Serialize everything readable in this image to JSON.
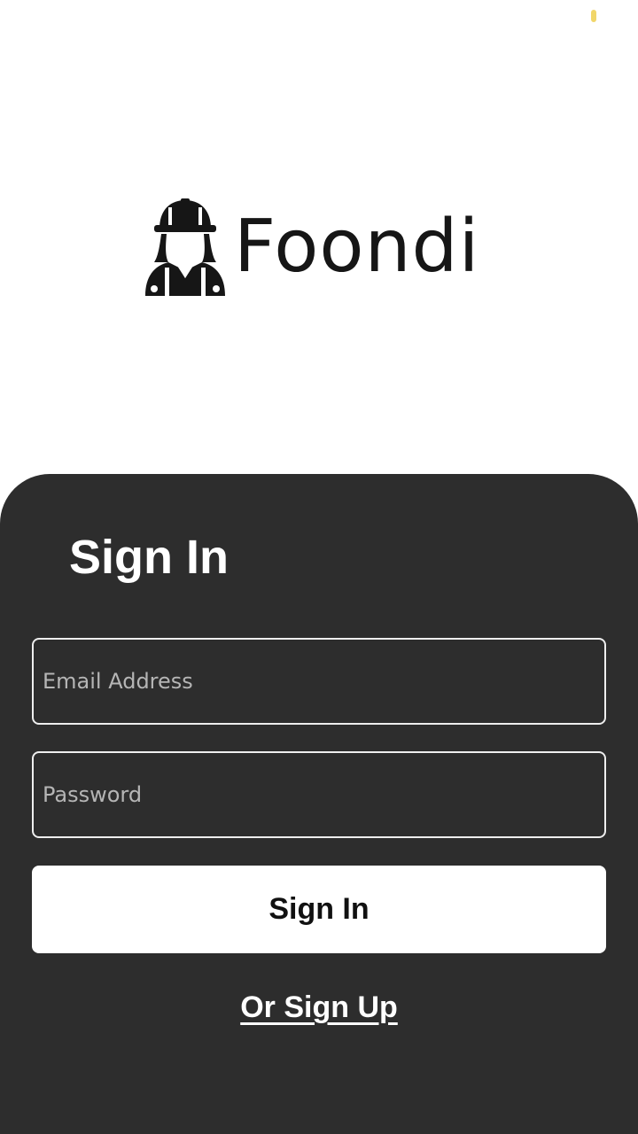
{
  "status_bar": {
    "indicator_color": "#f1d66a"
  },
  "brand": {
    "name": "Foondi",
    "icon": "worker-helmet-icon"
  },
  "signin": {
    "title": "Sign In",
    "email": {
      "value": "",
      "placeholder": "Email Address"
    },
    "password": {
      "value": "",
      "placeholder": "Password"
    },
    "submit_label": "Sign In",
    "signup_link_label": "Or Sign Up"
  },
  "colors": {
    "panel_background": "#2d2d2d",
    "page_background": "#ffffff",
    "button_background": "#ffffff"
  }
}
